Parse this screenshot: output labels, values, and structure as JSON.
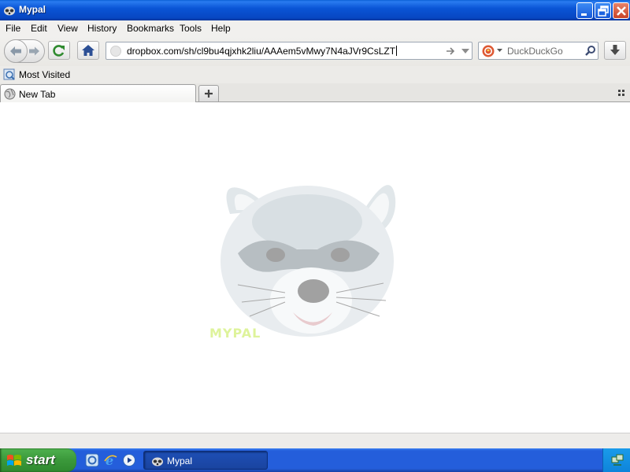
{
  "window": {
    "title": "Mypal"
  },
  "menu": {
    "items": [
      {
        "label": "File"
      },
      {
        "label": "Edit"
      },
      {
        "label": "View"
      },
      {
        "label": "History"
      },
      {
        "label": "Bookmarks"
      },
      {
        "label": "Tools"
      },
      {
        "label": "Help"
      }
    ]
  },
  "navbar": {
    "url": "dropbox.com/sh/cl9bu4qjxhk2liu/AAAem5vMwy7N4aJVr9CsLZT",
    "search_placeholder": "DuckDuckGo",
    "icons": [
      "back-icon",
      "forward-icon",
      "reload-icon",
      "home-icon",
      "go-arrow-icon",
      "dropdown-icon",
      "search-engine-icon",
      "search-icon",
      "download-icon"
    ]
  },
  "bookmarks": {
    "items": [
      {
        "label": "Most Visited"
      }
    ]
  },
  "tabs": {
    "items": [
      {
        "label": "New Tab"
      }
    ]
  },
  "content": {
    "watermark": "MYPAL"
  },
  "taskbar": {
    "start_label": "start",
    "tasks": [
      {
        "label": "Mypal"
      }
    ]
  },
  "colors": {
    "titlebar": "#0a55d6",
    "taskbar": "#245edb",
    "start_button": "#3c9a3c",
    "close_button": "#c94327"
  }
}
